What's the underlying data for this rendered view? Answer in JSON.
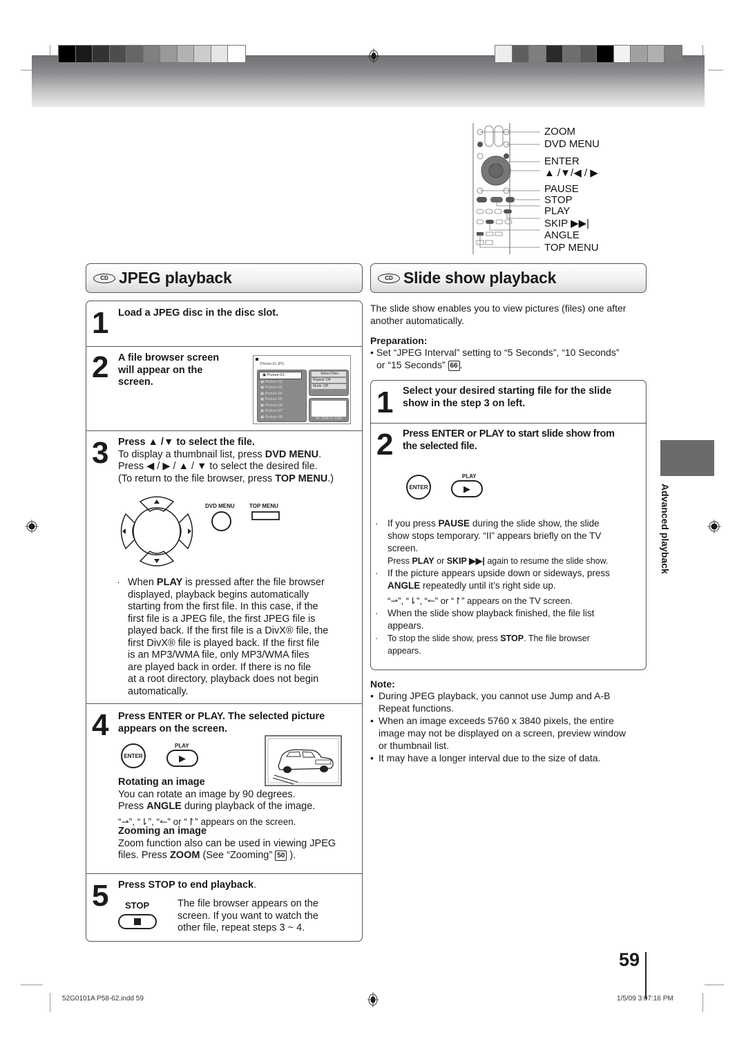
{
  "header": {
    "swatches_left": [
      "#000000",
      "#1a1a1a",
      "#333333",
      "#4d4d4d",
      "#666666",
      "#808080",
      "#999999",
      "#b3b3b3",
      "#cccccc",
      "#e6e6e6",
      "#ffffff"
    ],
    "swatches_right": [
      "#eeeeee",
      "#5e5e5e",
      "#7e7e7e",
      "#2a2a2a",
      "#6e6e6e",
      "#5a5a5a",
      "#000000",
      "#f2f2f2",
      "#a0a0a0",
      "#b0b0b0",
      "#7e7e7e"
    ]
  },
  "remote": {
    "labels": [
      "ZOOM",
      "DVD MENU",
      "ENTER",
      "▲ /▼/◀ / ▶",
      "PAUSE",
      "STOP",
      "PLAY",
      "SKIP ▶▶|",
      "ANGLE",
      "TOP MENU"
    ]
  },
  "jpeg": {
    "badge": "CD",
    "title": "JPEG playback",
    "steps": [
      {
        "num": "1",
        "text": "Load a JPEG disc in the disc slot."
      },
      {
        "num": "2",
        "text_lines": [
          "A file browser screen",
          "will appear on the",
          "screen."
        ]
      },
      {
        "num": "3",
        "heading": "Press ▲ /▼ to select the file.",
        "line1_pre": "To display a thumbnail list, press ",
        "line1_bold": "DVD MENU",
        "line1_post": ".",
        "line2": "Press ◀ / ▶ / ▲ / ▼ to select the desired file.",
        "line3_pre": "(To return to the file browser, press ",
        "line3_bold": "TOP MENU",
        "line3_post": ".)",
        "dvd_menu_label": "DVD MENU",
        "top_menu_label": "TOP MENU",
        "bullet_pre": "When ",
        "bullet_bold": "PLAY",
        "bullet_lines": [
          " is pressed after the file browser",
          "displayed, playback begins automatically",
          "starting from the first file. In this case, if the",
          "first file is a JPEG file, the first JPEG file is",
          "played back. If the first file is a DivX® file, the",
          "first DivX® file is played back. If the first file",
          "is an MP3/WMA file, only MP3/WMA files",
          "are played back in order. If there is no file",
          "at a root directory, playback does not begin",
          "automatically."
        ]
      },
      {
        "num": "4",
        "heading_lines": [
          "Press ENTER or PLAY. The selected picture",
          "appears on the screen."
        ],
        "enter_label": "ENTER",
        "play_label": "PLAY",
        "rotating_title": "Rotating an image",
        "rotating_line1": "You can rotate an image by 90 degrees.",
        "rotating_line2_pre": "Press ",
        "rotating_line2_bold": "ANGLE",
        "rotating_line2_post": " during playback of the image.",
        "rotating_line3": "“⇀”, “⇂”, “↼” or “↾” appears on the screen.",
        "zooming_title": "Zooming an image",
        "zooming_line1": "Zoom function also can be used in viewing JPEG",
        "zooming_line2_pre": "files. Press ",
        "zooming_line2_bold": "ZOOM",
        "zooming_line2_post": " (See “Zooming”",
        "zooming_ref": "50",
        "zooming_line2_end": " )."
      },
      {
        "num": "5",
        "heading_pre": "Press STOP to end playback",
        "heading_post": ".",
        "stop_label": "STOP",
        "text_lines": [
          "The file browser appears on the",
          "screen. If you want to watch the",
          "other file, repeat steps 3 ~ 4."
        ]
      }
    ],
    "file_browser": {
      "path": "/Picture-01.JPG",
      "files": [
        "Picture-01",
        "Picture-02",
        "Picture-03",
        "Picture-04",
        "Picture-05",
        "Picture-06",
        "Picture-07",
        "Picture-08"
      ],
      "selected": "Picture-01",
      "options": [
        "Select Files",
        "Repeat    :Off",
        "Mode      :Off"
      ],
      "resolution": "W: 2046  H: 1536"
    }
  },
  "slideshow": {
    "badge": "CD",
    "title": "Slide show playback",
    "intro": [
      "The slide show enables you to view pictures (files) one after",
      "another automatically."
    ],
    "preparation_title": "Preparation:",
    "preparation_lines": [
      "• Set “JPEG Interval” setting to “5 Seconds”, “10 Seconds”",
      "or “15 Seconds”"
    ],
    "preparation_ref": "66",
    "steps": [
      {
        "num": "1",
        "text_lines": [
          "Select your desired starting file for the slide",
          "show in the step 3 on left."
        ]
      },
      {
        "num": "2",
        "text_lines": [
          "Press ENTER or PLAY to start slide show from",
          "the selected file."
        ],
        "enter_label": "ENTER",
        "play_label": "PLAY"
      }
    ],
    "bullets": {
      "pause_pre": "If you press ",
      "pause_bold": "PAUSE",
      "pause_post": " during the slide show, the slide",
      "pause_line2": "show stops temporary. “II” appears briefly on the TV",
      "pause_line3": "screen.",
      "resume_pre": "Press ",
      "resume_bold1": "PLAY",
      "resume_mid": " or ",
      "resume_bold2": "SKIP ▶▶|",
      "resume_post": " again to resume the slide show.",
      "angle_line1": "If the picture appears upside down or sideways, press",
      "angle_bold": "ANGLE",
      "angle_post": " repeatedly until it’s right side up.",
      "angle_line3": "“⇀”, “⇂”, “↼” or “↾” appears on the TV screen.",
      "finished_line1": "When the slide show playback finished, the file list",
      "finished_line2": "appears.",
      "stop_pre": "To stop the slide show, press ",
      "stop_bold": "STOP",
      "stop_post": ". The file browser",
      "stop_line2": "appears."
    },
    "note_title": "Note:",
    "notes": [
      [
        "During JPEG playback, you cannot use Jump and A-B",
        "Repeat functions."
      ],
      [
        "When an image exceeds 5760 x 3840 pixels, the entire",
        "image may not be displayed on a screen, preview window",
        "or thumbnail list."
      ],
      [
        "It may have a longer interval due to the size of data."
      ]
    ]
  },
  "side_tab": {
    "label": "Advanced playback"
  },
  "footer": {
    "page_number": "59",
    "file_info": "52G0101A P58-62.indd   59",
    "date_time": "1/5/09   3:07:16 PM"
  }
}
